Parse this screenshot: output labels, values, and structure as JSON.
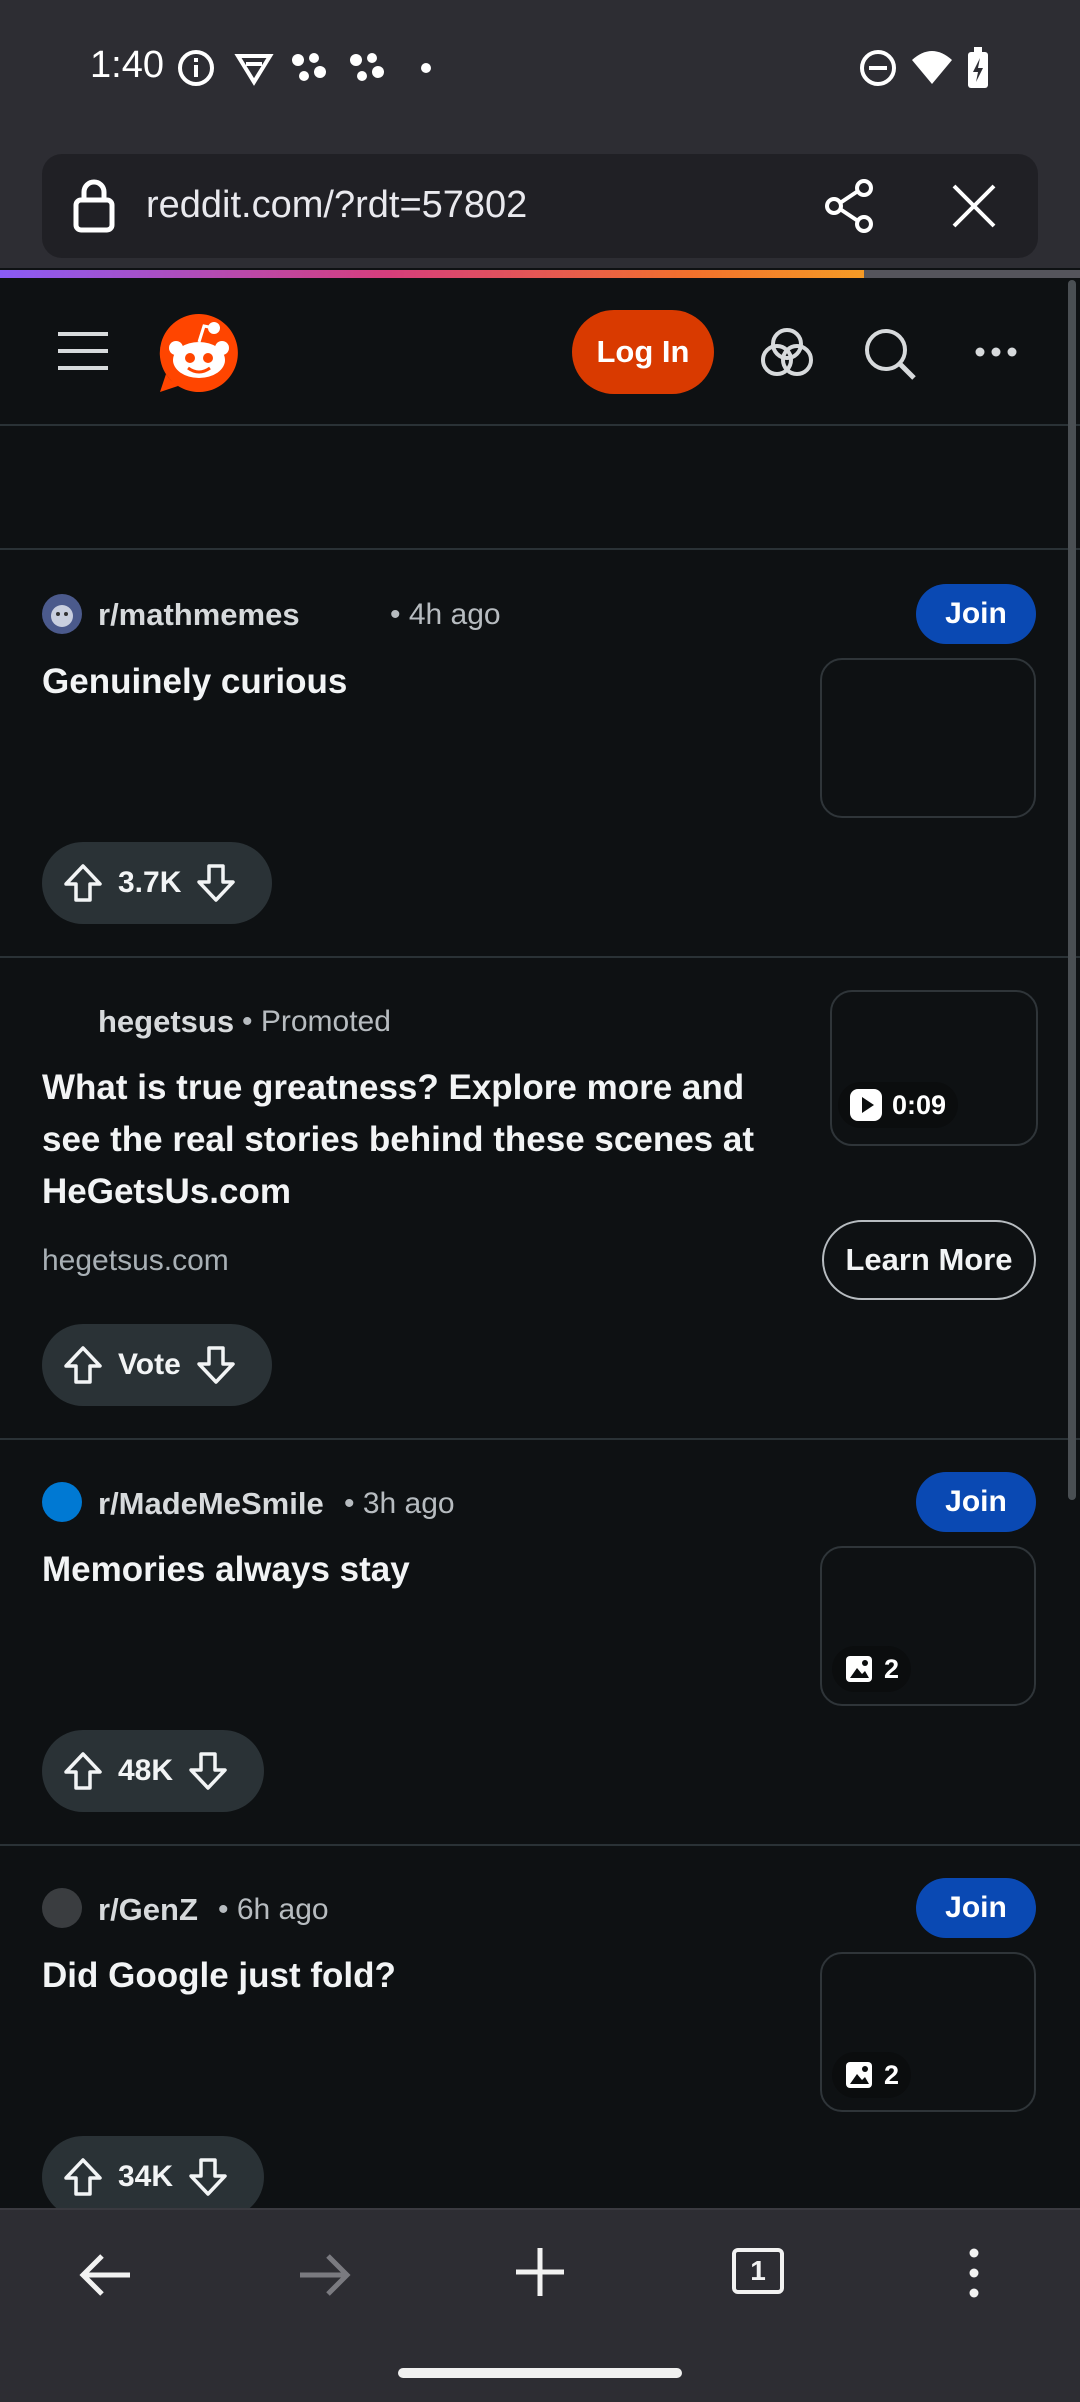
{
  "status_bar": {
    "time": "1:40"
  },
  "browser": {
    "url": "reddit.com/?rdt=57802",
    "load_progress": 0.8
  },
  "header": {
    "login_label": "Log In"
  },
  "posts": [
    {
      "subreddit": "r/mathmemes",
      "age": "• 4h ago",
      "join_label": "Join",
      "title": "Genuinely curious",
      "votes": "3.7K"
    },
    {
      "advertiser": "hegetsus",
      "promoted": "• Promoted",
      "title": "What is true greatness? Explore more and see the real stories behind these scenes at HeGetsUs.com",
      "domain": "hegetsus.com",
      "video_duration": "0:09",
      "cta_label": "Learn More",
      "votes": "Vote"
    },
    {
      "subreddit": "r/MadeMeSmile",
      "age": "• 3h ago",
      "join_label": "Join",
      "title": "Memories always stay",
      "image_count": "2",
      "votes": "48K"
    },
    {
      "subreddit": "r/GenZ",
      "age": "• 6h ago",
      "join_label": "Join",
      "title": "Did Google just fold?",
      "image_count": "2",
      "votes": "34K"
    }
  ],
  "bottom_nav": {
    "tab_count": "1"
  },
  "colors": {
    "accent_orange": "#d93a00",
    "join_blue": "#0a49b3",
    "background": "#0e1113",
    "chrome": "#2d2d33"
  }
}
